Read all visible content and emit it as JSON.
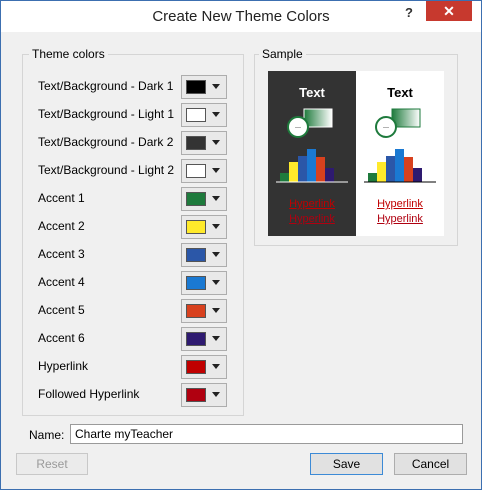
{
  "window": {
    "title": "Create New Theme Colors",
    "help_glyph": "?",
    "close_glyph": "✕"
  },
  "theme_colors": {
    "legend": "Theme colors",
    "rows": [
      {
        "label": "Text/Background - Dark 1",
        "color": "#000000"
      },
      {
        "label": "Text/Background - Light 1",
        "color": "#ffffff"
      },
      {
        "label": "Text/Background - Dark 2",
        "color": "#333333"
      },
      {
        "label": "Text/Background - Light 2",
        "color": "#ffffff"
      },
      {
        "label": "Accent 1",
        "color": "#1e7a3c"
      },
      {
        "label": "Accent 2",
        "color": "#ffea2b"
      },
      {
        "label": "Accent 3",
        "color": "#2b57a8"
      },
      {
        "label": "Accent 4",
        "color": "#1a79d2"
      },
      {
        "label": "Accent 5",
        "color": "#d8411e"
      },
      {
        "label": "Accent 6",
        "color": "#2e1a70"
      },
      {
        "label": "Hyperlink",
        "color": "#c00000"
      },
      {
        "label": "Followed Hyperlink",
        "color": "#b00010"
      }
    ]
  },
  "sample": {
    "legend": "Sample",
    "text_label": "Text",
    "hyperlink_label": "Hyperlink",
    "followed_hyperlink_label": "Hyperlink"
  },
  "name": {
    "label": "Name:",
    "value": "Charte myTeacher"
  },
  "buttons": {
    "reset": "Reset",
    "save": "Save",
    "cancel": "Cancel"
  }
}
